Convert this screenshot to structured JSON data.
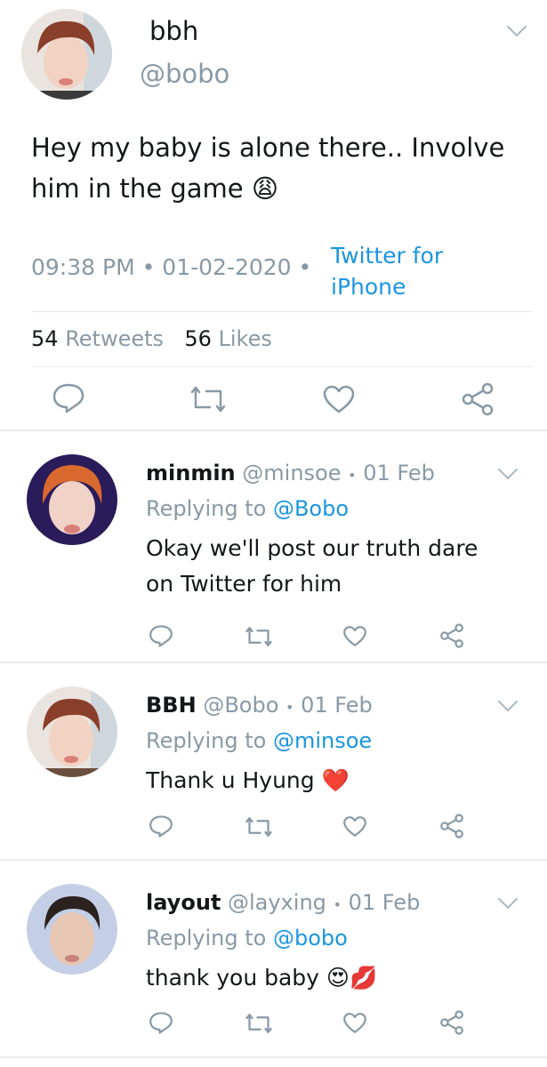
{
  "main_tweet": {
    "display_name": "bbh",
    "handle": "@bobo",
    "text": "Hey my baby is alone there.. Involve him in the game 😩",
    "time": "09:38 PM",
    "date": "01-02-2020",
    "source_line1": "Twitter for",
    "source_line2": "iPhone",
    "retweets_count": "54",
    "retweets_label": "Retweets",
    "likes_count": "56",
    "likes_label": "Likes"
  },
  "replies": [
    {
      "display_name": "minmin",
      "handle": "@minsoe",
      "date": "01 Feb",
      "replying_label": "Replying to",
      "replying_handle": "@Bobo",
      "line1": "Okay we'll post our truth dare",
      "line2": "on Twitter for him"
    },
    {
      "display_name": "BBH",
      "handle": "@Bobo",
      "date": "01 Feb",
      "replying_label": "Replying to",
      "replying_handle": "@minsoe",
      "line1": "Thank u Hyung ❤️"
    },
    {
      "display_name": "layout",
      "handle": "@layxing",
      "date": "01 Feb",
      "replying_label": "Replying to",
      "replying_handle": "@bobo",
      "line1": "thank you baby 😍💋"
    }
  ],
  "separator": "•",
  "colors": {
    "link": "#1b95e0",
    "muted": "#8899a6",
    "icon": "#8899a6",
    "divider": "#e6ecf0"
  },
  "icons": [
    "chevron-down-icon",
    "reply-icon",
    "retweet-icon",
    "like-icon",
    "share-icon"
  ]
}
